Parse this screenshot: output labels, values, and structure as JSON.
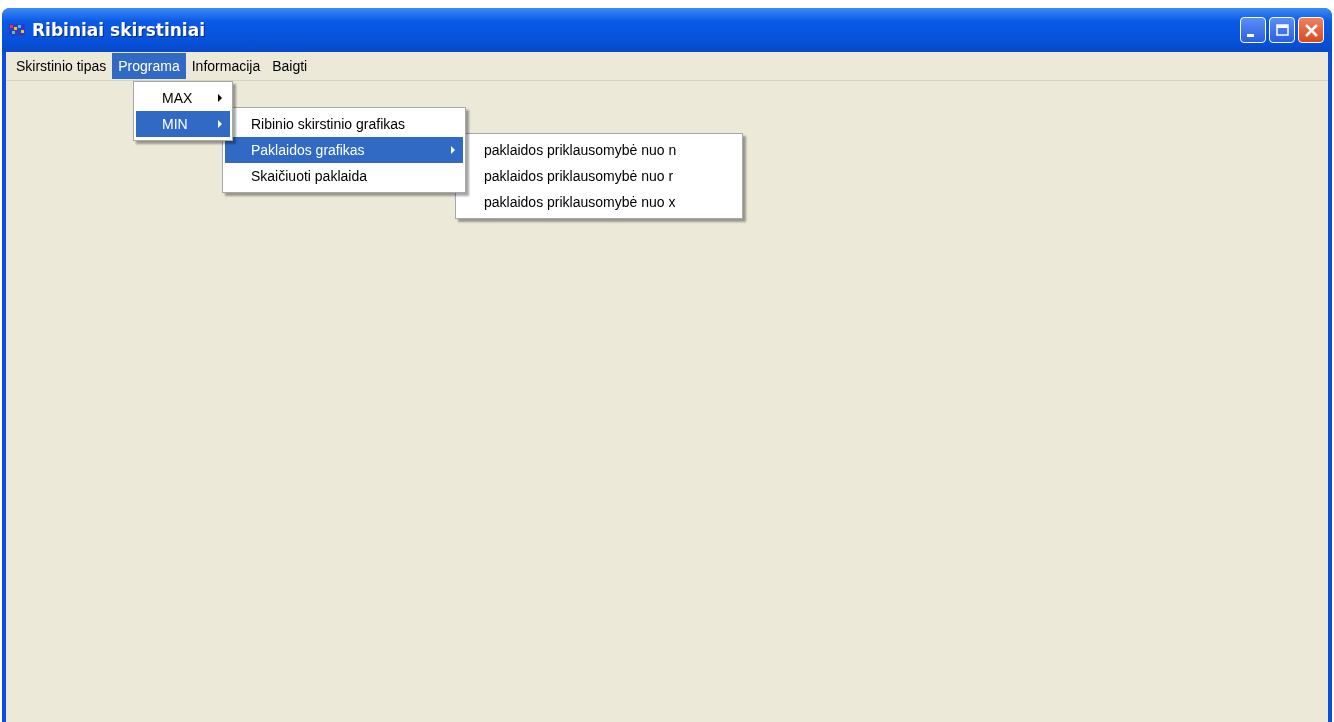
{
  "window": {
    "title": "Ribiniai skirstiniai"
  },
  "menu_bar": [
    {
      "label": "Skirstinio tipas",
      "selected": false
    },
    {
      "label": "Programa",
      "selected": true,
      "children": [
        {
          "label": "MAX",
          "submenu": true,
          "selected": false
        },
        {
          "label": "MIN",
          "submenu": true,
          "selected": true,
          "children": [
            {
              "label": "Ribinio skirstinio grafikas",
              "submenu": false,
              "selected": false
            },
            {
              "label": "Paklaidos grafikas",
              "submenu": true,
              "selected": true,
              "children": [
                {
                  "label": "paklaidos priklausomybė nuo n",
                  "submenu": false,
                  "selected": false
                },
                {
                  "label": "paklaidos priklausomybė nuo r",
                  "submenu": false,
                  "selected": false
                },
                {
                  "label": "paklaidos priklausomybė nuo x",
                  "submenu": false,
                  "selected": false
                }
              ]
            },
            {
              "label": "Skaičiuoti paklaida",
              "submenu": false,
              "selected": false
            }
          ]
        }
      ]
    },
    {
      "label": "Informacija",
      "selected": false
    },
    {
      "label": "Baigti",
      "selected": false
    }
  ]
}
